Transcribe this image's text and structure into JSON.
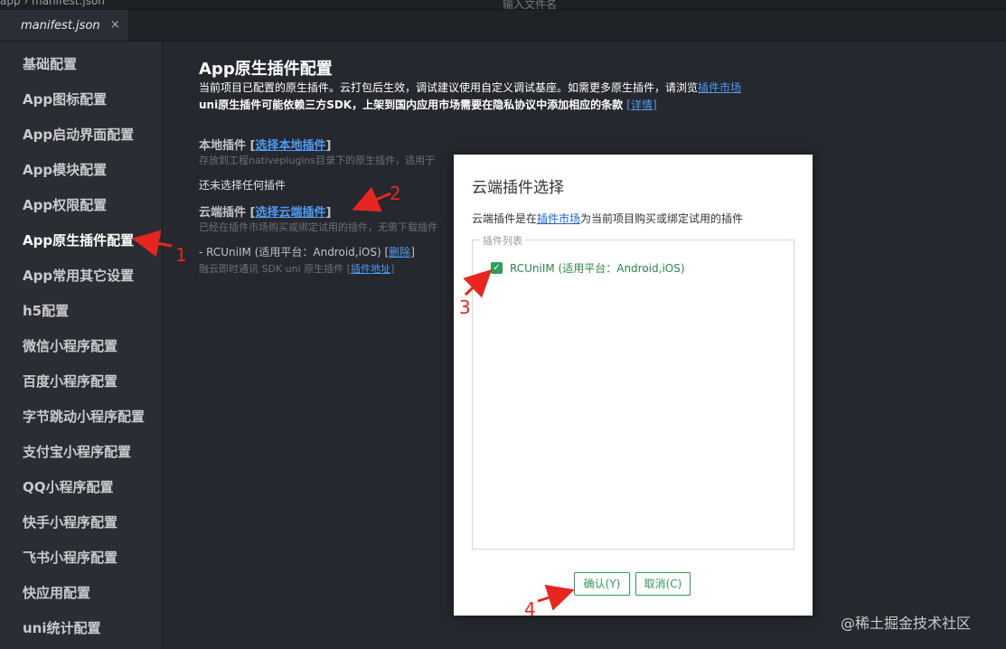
{
  "topbar": {
    "crumb": "app  ›  manifest.json",
    "search_placeholder": "输入文件名"
  },
  "tab": {
    "label": "manifest.json",
    "close": "×"
  },
  "sidebar": {
    "items": [
      {
        "label": "基础配置"
      },
      {
        "label": "App图标配置"
      },
      {
        "label": "App启动界面配置"
      },
      {
        "label": "App模块配置"
      },
      {
        "label": "App权限配置"
      },
      {
        "label": "App原生插件配置",
        "active": true
      },
      {
        "label": "App常用其它设置"
      },
      {
        "label": "h5配置"
      },
      {
        "label": "微信小程序配置"
      },
      {
        "label": "百度小程序配置"
      },
      {
        "label": "字节跳动小程序配置"
      },
      {
        "label": "支付宝小程序配置"
      },
      {
        "label": "QQ小程序配置"
      },
      {
        "label": "快手小程序配置"
      },
      {
        "label": "飞书小程序配置"
      },
      {
        "label": "快应用配置"
      },
      {
        "label": "uni统计配置"
      }
    ]
  },
  "main": {
    "title": "App原生插件配置",
    "desc1_text": "当前项目已配置的原生插件。云打包后生效，调试建议使用自定义调试基座。如需更多原生插件，请浏览",
    "desc1_link": "插件市场",
    "desc2_text": "uni原生插件可能依赖三方SDK，上架到国内应用市场需要在隐私协议中添加相应的条款",
    "desc2_link": "[详情]",
    "local": {
      "head": "本地插件 [",
      "link": "选择本地插件",
      "tail": "]",
      "note": "存放到工程nativeplugins目录下的原生插件，适用于"
    },
    "none_selected": "还未选择任何插件",
    "cloud": {
      "head": "云端插件 [",
      "link": "选择云端插件",
      "tail": "]",
      "note": "已经在插件市场购买或绑定试用的插件，无需下载插件"
    },
    "plugin": {
      "line": "- RCUniIM (适用平台：Android,iOS) [",
      "delete": "删除",
      "tail": "]",
      "sub": "融云即时通讯 SDK uni 原生插件 [",
      "sub_link": "插件地址",
      "sub_tail": "]"
    }
  },
  "dialog": {
    "title": "云端插件选择",
    "desc_pre": "云端插件是在",
    "desc_link": "插件市场",
    "desc_post": "为当前项目购买或绑定试用的插件",
    "legend": "插件列表",
    "checkbox_label": "RCUniIM (适用平台：Android,iOS)",
    "checked": true,
    "ok": "确认(Y)",
    "cancel": "取消(C)"
  },
  "annotations": [
    "1",
    "2",
    "3",
    "4"
  ],
  "watermark": "@稀土掘金技术社区",
  "colors": {
    "accent_green": "#2e9f59",
    "link_blue": "#4e9bf0",
    "annotation_red": "#e8261f"
  }
}
